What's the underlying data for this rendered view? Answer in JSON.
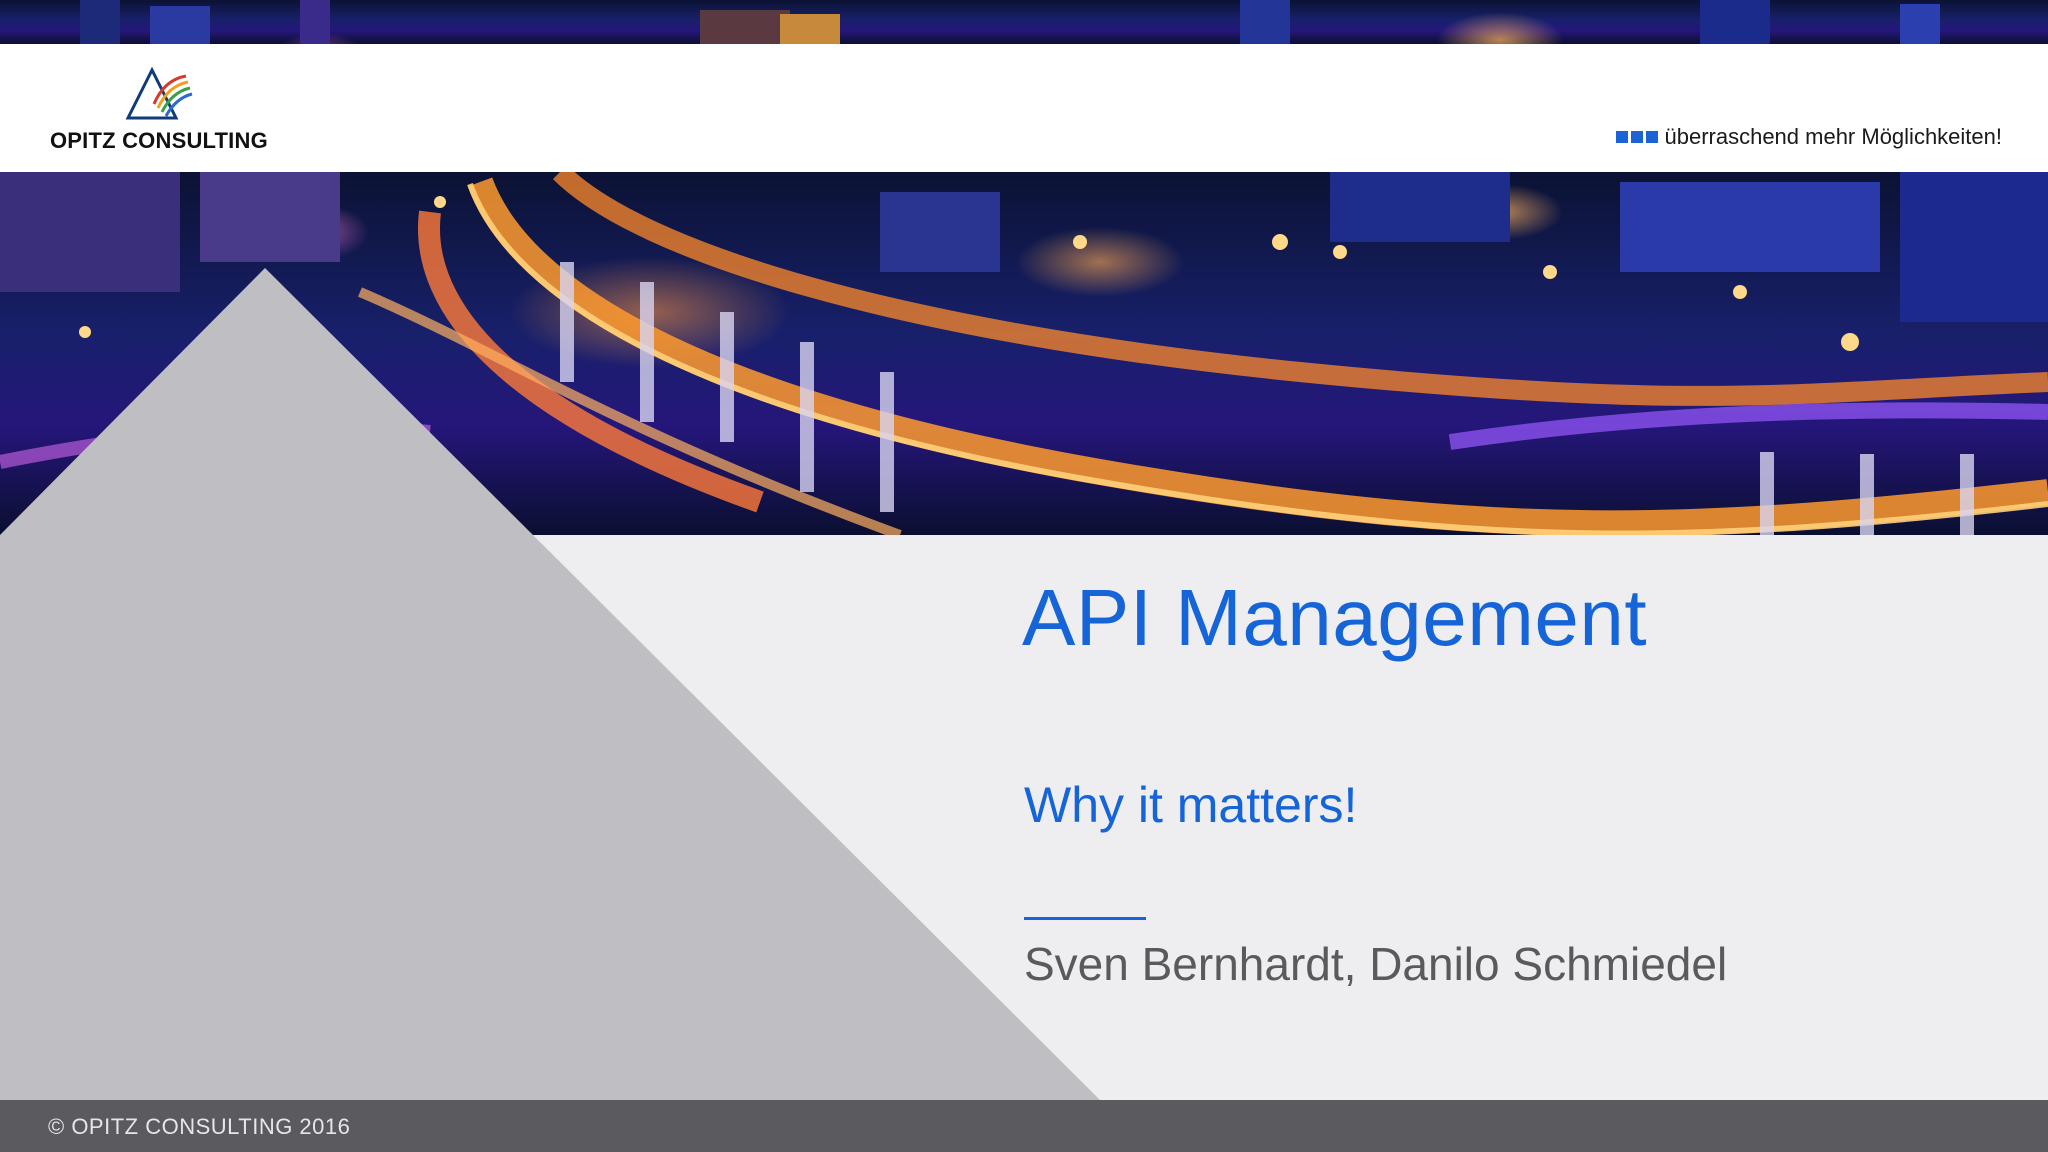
{
  "brand": {
    "logo_text": "OPITZ CONSULTING",
    "tagline": "überraschend mehr Möglichkeiten!",
    "accent_color": "#1565d8"
  },
  "slide": {
    "title": "API Management",
    "subtitle": "Why it matters!",
    "authors": "Sven Bernhardt, Danilo Schmiedel"
  },
  "footer": {
    "copyright": "© OPITZ CONSULTING 2016"
  },
  "icons": {
    "logo": "opitz-triangle-logo-icon",
    "tagline_marker": "three-squares-icon"
  }
}
